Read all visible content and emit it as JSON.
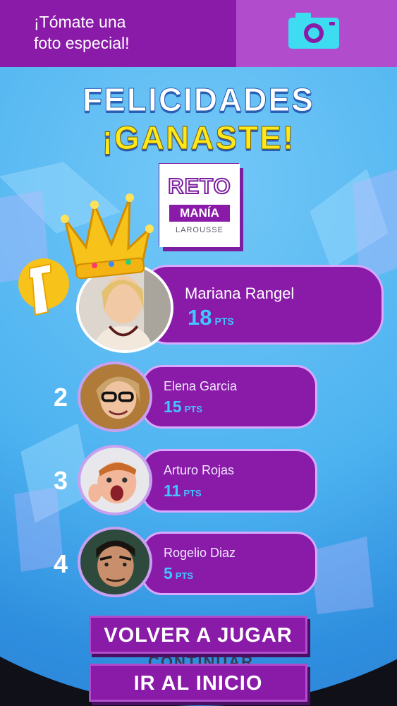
{
  "header": {
    "photo_prompt": "¡Tómate una\nfoto especial!",
    "camera_icon": "camera-icon"
  },
  "headline": {
    "line1": "FELICIDADES",
    "line2": "¡GANASTE!"
  },
  "logo": {
    "reto": "RETO",
    "mania": "MANÍA",
    "publisher": "LAROUSSE"
  },
  "leaderboard": [
    {
      "rank": "1",
      "name": "Mariana Rangel",
      "points": "18",
      "unit": "PTS"
    },
    {
      "rank": "2",
      "name": "Elena Garcia",
      "points": "15",
      "unit": "PTS"
    },
    {
      "rank": "3",
      "name": "Arturo Rojas",
      "points": "11",
      "unit": "PTS"
    },
    {
      "rank": "4",
      "name": "Rogelio Diaz",
      "points": "5",
      "unit": "PTS"
    }
  ],
  "buttons": {
    "play_again": "VOLVER A JUGAR",
    "continue_hidden": "CONTINUAR",
    "home": "IR AL INICIO"
  },
  "colors": {
    "purple": "#8a1aa8",
    "sky": "#4db3f0",
    "yellow": "#ffe81a",
    "score_blue": "#42c6ff"
  }
}
